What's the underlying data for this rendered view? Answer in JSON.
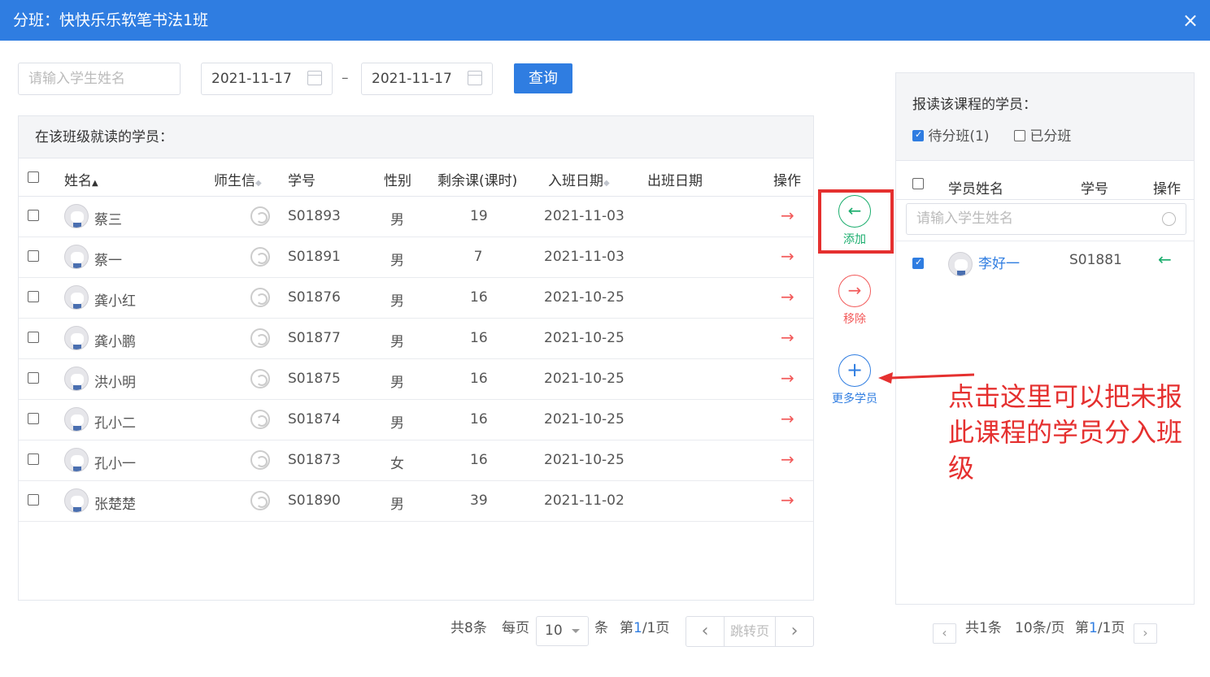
{
  "dialog": {
    "title": "分班：快快乐乐软笔书法1班",
    "close_icon": "×"
  },
  "filters": {
    "name_placeholder": "请输入学生姓名",
    "date_from": "2021-11-17",
    "date_to": "2021-11-17",
    "separator": "–",
    "query_label": "查询"
  },
  "left": {
    "heading": "在该班级就读的学员：",
    "columns": [
      "姓名",
      "师生信",
      "学号",
      "性别",
      "剩余课(课时)",
      "入班日期",
      "出班日期",
      "操作"
    ],
    "rows": [
      {
        "name": "蔡三",
        "id": "S01893",
        "gender": "男",
        "remaining": "19",
        "join": "2021-11-03"
      },
      {
        "name": "蔡一",
        "id": "S01891",
        "gender": "男",
        "remaining": "7",
        "join": "2021-11-03"
      },
      {
        "name": "龚小红",
        "id": "S01876",
        "gender": "男",
        "remaining": "16",
        "join": "2021-10-25"
      },
      {
        "name": "龚小鹏",
        "id": "S01877",
        "gender": "男",
        "remaining": "16",
        "join": "2021-10-25"
      },
      {
        "name": "洪小明",
        "id": "S01875",
        "gender": "男",
        "remaining": "16",
        "join": "2021-10-25"
      },
      {
        "name": "孔小二",
        "id": "S01874",
        "gender": "男",
        "remaining": "16",
        "join": "2021-10-25"
      },
      {
        "name": "孔小一",
        "id": "S01873",
        "gender": "女",
        "remaining": "16",
        "join": "2021-10-25"
      },
      {
        "name": "张楚楚",
        "id": "S01890",
        "gender": "男",
        "remaining": "39",
        "join": "2021-11-02"
      }
    ],
    "pager": {
      "total": "共8条",
      "per_page_label": "每页",
      "per_page": "10",
      "unit": "条",
      "page_prefix": "第",
      "page_current": "1",
      "page_suffix": "/1页",
      "jump": "跳转页"
    }
  },
  "middle": {
    "add_label": "添加",
    "remove_label": "移除",
    "more_label": "更多学员"
  },
  "right": {
    "heading": "报读该课程的学员：",
    "opt_pending": "待分班(1)",
    "opt_assigned": "已分班",
    "columns": [
      "学员姓名",
      "学号",
      "操作"
    ],
    "search_placeholder": "请输入学生姓名",
    "rows": [
      {
        "name": "李好一",
        "id": "S01881"
      }
    ],
    "pager": {
      "total": "共1条",
      "per_page": "10条/页",
      "page_prefix": "第",
      "page_current": "1",
      "page_suffix": "/1页"
    }
  },
  "annotation": {
    "text": "点击这里可以把未报此课程的学员分入班级"
  },
  "colors": {
    "primary": "#2f7de1",
    "danger": "#f25a5a",
    "success": "#1aad6d",
    "annotation": "#e5302f"
  }
}
